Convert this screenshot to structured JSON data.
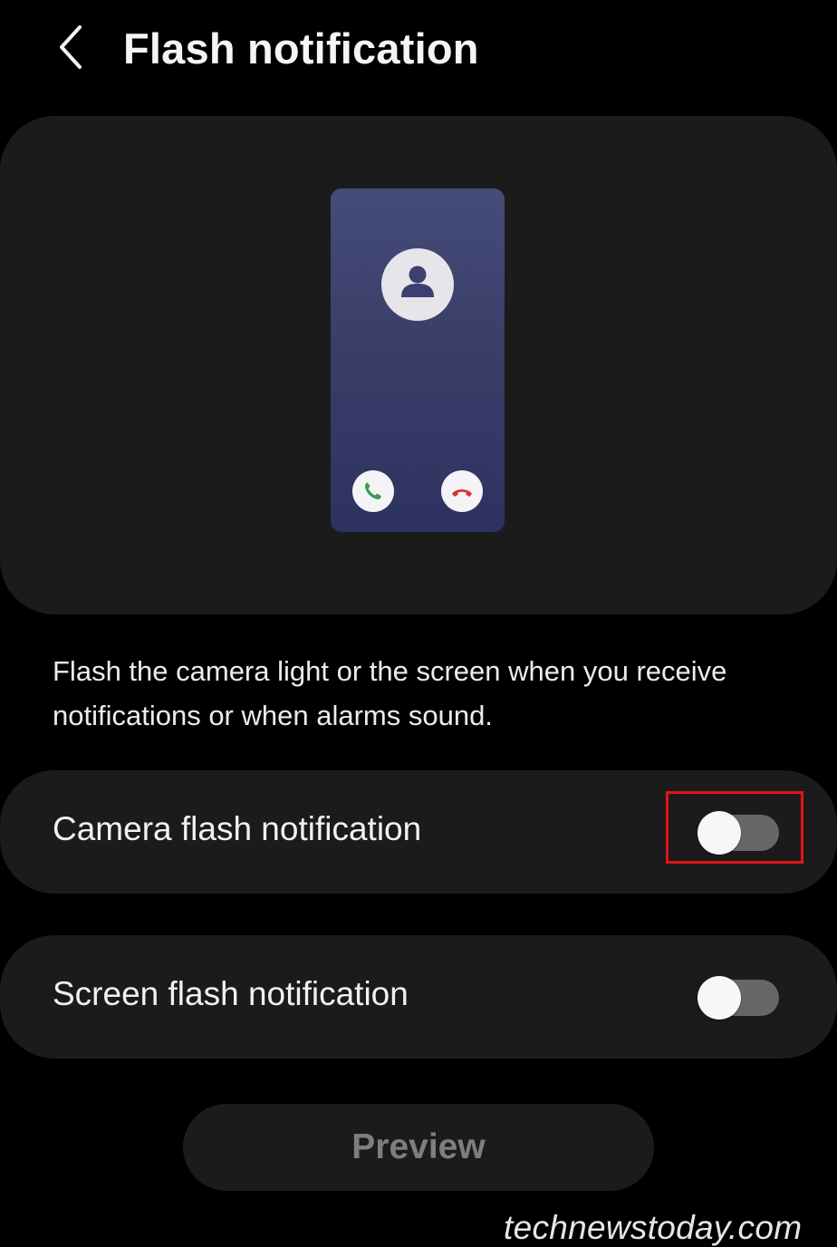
{
  "header": {
    "back_icon": "chevron-left-icon",
    "title": "Flash notification"
  },
  "illustration": {
    "avatar_icon": "person-icon",
    "accept_icon": "phone-accept-icon",
    "decline_icon": "phone-decline-icon",
    "accept_color": "#3a9a56",
    "decline_color": "#d6322e"
  },
  "description": "Flash the camera light or the screen when you receive notifications or when alarms sound.",
  "settings": [
    {
      "label": "Camera flash notification",
      "enabled": false,
      "highlighted": true
    },
    {
      "label": "Screen flash notification",
      "enabled": false,
      "highlighted": false
    }
  ],
  "preview_button": {
    "label": "Preview",
    "enabled": false
  },
  "watermark": "technewstoday.com",
  "colors": {
    "background": "#000000",
    "card": "#1b1b1b",
    "highlight": "#e0141b",
    "toggle_track_off": "#67676a"
  }
}
